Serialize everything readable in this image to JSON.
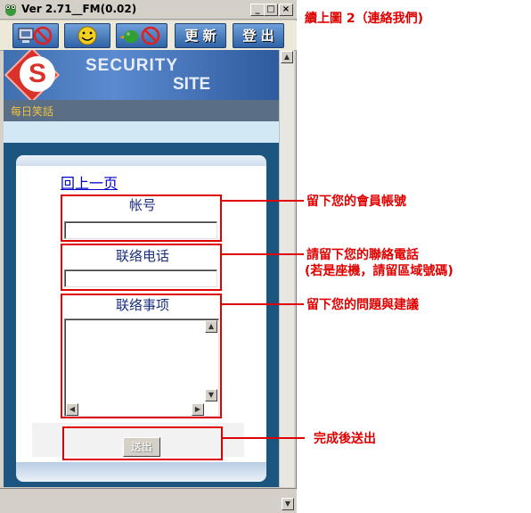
{
  "window": {
    "title": "Ver 2.71__FM(0.02)",
    "controls": {
      "minimize": "_",
      "maximize": "□",
      "close": "×"
    }
  },
  "toolbar": {
    "buttons": [
      {
        "name": "no-computer",
        "icon": "prohibited-computer-icon"
      },
      {
        "name": "smiley",
        "icon": "smiley-face-icon"
      },
      {
        "name": "no-bird",
        "icon": "prohibited-bird-icon"
      }
    ],
    "text_buttons": [
      {
        "label": "更新",
        "chars": [
          "更",
          "新"
        ]
      },
      {
        "label": "登出",
        "chars": [
          "登",
          "出"
        ]
      }
    ]
  },
  "banner": {
    "brand_line1": "SECURITY",
    "brand_line2": "SITE",
    "logo_letter": "S"
  },
  "nav": {
    "link": "每日笑話"
  },
  "form": {
    "back_link": "回上一页",
    "account_label": "帐号",
    "phone_label": "联络电话",
    "matters_label": "联络事项",
    "submit_label": "送出",
    "scroll_up": "▲",
    "scroll_down": "▼",
    "scroll_left": "◀",
    "scroll_right": "▶"
  },
  "annotations": {
    "heading": "續上圖 2（連絡我們)",
    "account_note": "留下您的會員帳號",
    "phone_note_line1": "請留下您的聯絡電話",
    "phone_note_line2": "(若是座機，請留區域號碼)",
    "matters_note": "留下您的問題與建議",
    "submit_note": "完成後送出"
  },
  "colors": {
    "annotation_red": "#e00000",
    "banner_blue": "#3f6fae",
    "panel_blue": "#1c5580",
    "link_blue": "#0000cc",
    "label_navy": "#1c2f7c"
  }
}
